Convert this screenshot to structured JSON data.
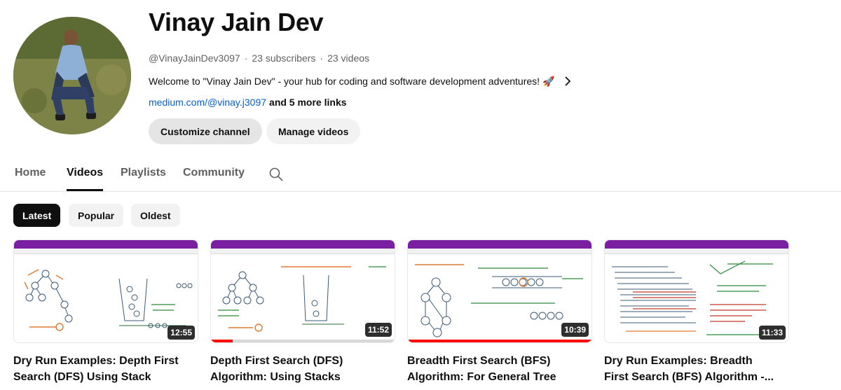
{
  "channel": {
    "name": "Vinay Jain Dev",
    "handle": "@VinayJainDev3097",
    "subscribers": "23 subscribers",
    "videos_count": "23 videos",
    "meta_separator": "·",
    "description": "Welcome to \"Vinay Jain Dev\" - your hub for coding and software development adventures! 🚀",
    "link": "medium.com/@vinay.j3097",
    "more_links": "and 5 more links"
  },
  "buttons": {
    "customize": "Customize channel",
    "manage": "Manage videos"
  },
  "tabs": [
    {
      "label": "Home",
      "active": false
    },
    {
      "label": "Videos",
      "active": true
    },
    {
      "label": "Playlists",
      "active": false
    },
    {
      "label": "Community",
      "active": false
    }
  ],
  "chips": [
    {
      "label": "Latest",
      "active": true
    },
    {
      "label": "Popular",
      "active": false
    },
    {
      "label": "Oldest",
      "active": false
    }
  ],
  "videos": [
    {
      "title_line1": "Dry Run Examples: Depth First",
      "title_line2": "Search (DFS) Using Stack",
      "duration": "12:55",
      "watched_fraction": 0
    },
    {
      "title_line1": "Depth First Search (DFS)",
      "title_line2": "Algorithm: Using Stacks",
      "duration": "11:52",
      "watched_fraction": 0.12
    },
    {
      "title_line1": "Breadth First Search (BFS)",
      "title_line2": "Algorithm: For General Tree",
      "duration": "10:39",
      "watched_fraction": 1.0
    },
    {
      "title_line1": "Dry Run Examples: Breadth",
      "title_line2": "First Search (BFS) Algorithm -...",
      "duration": "11:33",
      "watched_fraction": 0
    }
  ],
  "colors": {
    "accent_link": "#065fd4",
    "progress": "#ff0000",
    "thumb_header": "#7a1fa2"
  }
}
